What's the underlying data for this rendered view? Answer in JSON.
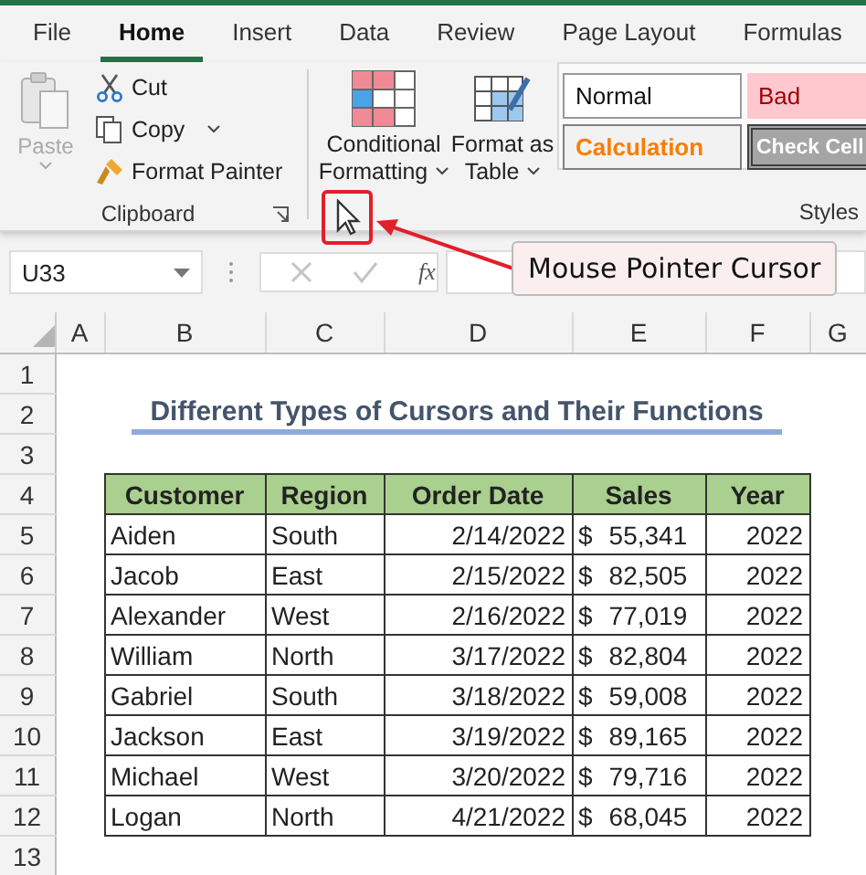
{
  "ribbon_tabs": [
    {
      "label": "File",
      "selected": false
    },
    {
      "label": "Home",
      "selected": true
    },
    {
      "label": "Insert",
      "selected": false
    },
    {
      "label": "Data",
      "selected": false
    },
    {
      "label": "Review",
      "selected": false
    },
    {
      "label": "Page Layout",
      "selected": false
    },
    {
      "label": "Formulas",
      "selected": false
    }
  ],
  "clipboard": {
    "paste": "Paste",
    "cut": "Cut",
    "copy": "Copy",
    "format_painter": "Format Painter",
    "group_label": "Clipboard"
  },
  "conditional_formatting": {
    "line_1": "Conditional",
    "line_2": "Formatting"
  },
  "format_as_table": {
    "line_1": "Format as",
    "line_2": "Table"
  },
  "styles": {
    "cells": [
      {
        "label": "Normal",
        "kind": "normal"
      },
      {
        "label": "Bad",
        "kind": "bad"
      },
      {
        "label": "Calculation",
        "kind": "calculation"
      },
      {
        "label": "Check Cell",
        "kind": "check"
      }
    ],
    "group_label": "Styles"
  },
  "name_box": "U33",
  "function_label": "fx",
  "callout": "Mouse Pointer Cursor",
  "columns": [
    "A",
    "B",
    "C",
    "D",
    "E",
    "F",
    "G"
  ],
  "rows": [
    "1",
    "2",
    "3",
    "4",
    "5",
    "6",
    "7",
    "8",
    "9",
    "10",
    "11",
    "12",
    "13"
  ],
  "sheet": {
    "title": "Different Types of Cursors and Their Functions",
    "headers": [
      "Customer",
      "Region",
      "Order Date",
      "Sales",
      "Year"
    ],
    "records": [
      {
        "customer": "Aiden",
        "region": "South",
        "date": "2/14/2022",
        "currency": "$",
        "amount": "55,341",
        "year": "2022"
      },
      {
        "customer": "Jacob",
        "region": "East",
        "date": "2/15/2022",
        "currency": "$",
        "amount": "82,505",
        "year": "2022"
      },
      {
        "customer": "Alexander",
        "region": "West",
        "date": "2/16/2022",
        "currency": "$",
        "amount": "77,019",
        "year": "2022"
      },
      {
        "customer": "William",
        "region": "North",
        "date": "3/17/2022",
        "currency": "$",
        "amount": "82,804",
        "year": "2022"
      },
      {
        "customer": "Gabriel",
        "region": "South",
        "date": "3/18/2022",
        "currency": "$",
        "amount": "59,008",
        "year": "2022"
      },
      {
        "customer": "Jackson",
        "region": "East",
        "date": "3/19/2022",
        "currency": "$",
        "amount": "89,165",
        "year": "2022"
      },
      {
        "customer": "Michael",
        "region": "West",
        "date": "3/20/2022",
        "currency": "$",
        "amount": "79,716",
        "year": "2022"
      },
      {
        "customer": "Logan",
        "region": "North",
        "date": "4/21/2022",
        "currency": "$",
        "amount": "68,045",
        "year": "2022"
      }
    ]
  }
}
